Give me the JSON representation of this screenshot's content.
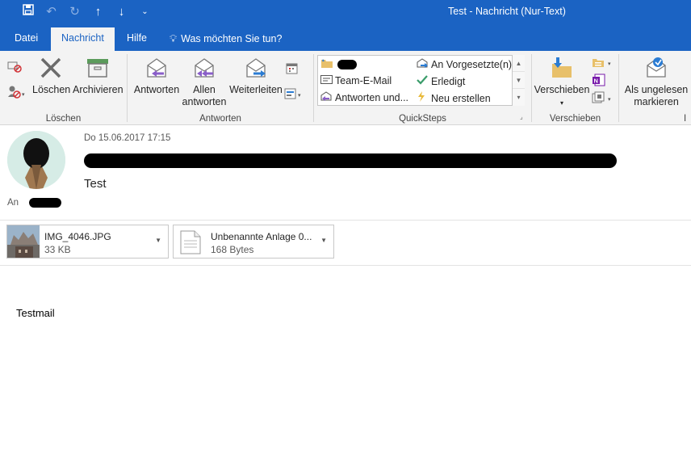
{
  "window": {
    "title": "Test  -  Nachricht (Nur-Text)"
  },
  "quick_access": [
    {
      "icon": "save-icon",
      "glyph": "💾"
    },
    {
      "icon": "undo-icon",
      "glyph": "↶"
    },
    {
      "icon": "redo-icon",
      "glyph": "↻"
    },
    {
      "icon": "arrow-up-icon",
      "glyph": "↑"
    },
    {
      "icon": "arrow-down-icon",
      "glyph": "↓"
    },
    {
      "icon": "customize-icon",
      "glyph": "⌄"
    }
  ],
  "tabs": [
    {
      "label": "Datei",
      "active": false
    },
    {
      "label": "Nachricht",
      "active": true
    },
    {
      "label": "Hilfe",
      "active": false
    }
  ],
  "tell_me": "Was möchten Sie tun?",
  "ribbon": {
    "loeschen": {
      "group_label": "Löschen",
      "delete_label": "Löschen",
      "archive_label": "Archivieren"
    },
    "antworten": {
      "group_label": "Antworten",
      "reply_label": "Antworten",
      "reply_all_label_1": "Allen",
      "reply_all_label_2": "antworten",
      "forward_label": "Weiterleiten"
    },
    "quicksteps": {
      "group_label": "QuickSteps",
      "items": [
        {
          "label": "",
          "icon": "folder-icon"
        },
        {
          "label": "Team-E-Mail",
          "icon": "mail-icon"
        },
        {
          "label": "Antworten und...",
          "icon": "reply-icon"
        },
        {
          "label": "An Vorgesetzte(n)",
          "icon": "forward-mail-icon"
        },
        {
          "label": "Erledigt",
          "icon": "checkmark-icon"
        },
        {
          "label": "Neu erstellen",
          "icon": "lightning-icon"
        }
      ]
    },
    "verschieben": {
      "group_label": "Verschieben",
      "move_label": "Verschieben"
    },
    "kategorien": {
      "unread_label_1": "Als ungelesen",
      "unread_label_2": "markieren"
    }
  },
  "message": {
    "date": "Do 15.06.2017 17:15",
    "subject": "Test",
    "to_label": "An",
    "body": "Testmail"
  },
  "attachments": [
    {
      "name": "IMG_4046.JPG",
      "size": "33 KB",
      "type": "image"
    },
    {
      "name": "Unbenannte Anlage 0...",
      "size": "168 Bytes",
      "type": "file"
    }
  ],
  "colors": {
    "accent": "#1b63c3",
    "ribbon_bg": "#f3f3f3"
  }
}
